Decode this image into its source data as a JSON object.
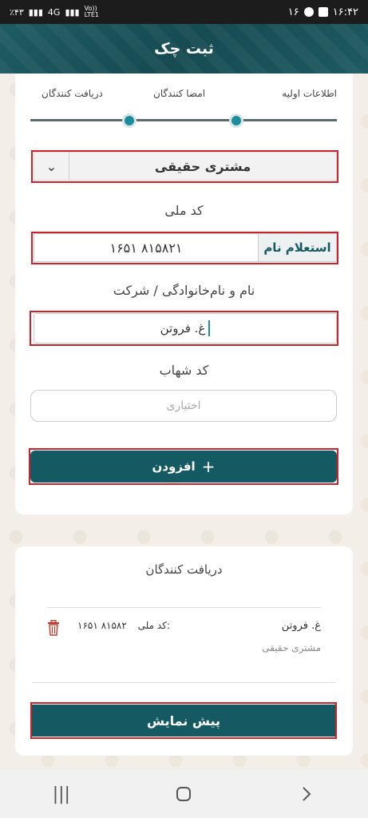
{
  "status_bar": {
    "time": "۱۶:۴۲",
    "notification_count": "۱۶",
    "battery": "٪۴۳",
    "network": "4G",
    "volte": "Vo))\nLTE1"
  },
  "header": {
    "title": "ثبت چک"
  },
  "stepper": {
    "steps": [
      {
        "label": "اطلاعات اولیه"
      },
      {
        "label": "امضا کنندگان"
      },
      {
        "label": "دریافت کنندگان"
      }
    ]
  },
  "form": {
    "customer_type": "مشتری حقیقی",
    "national_code_label": "کد ملی",
    "national_code_value": "۱۶۵۱ ۸۱۵۸۲۱",
    "inquiry_button": "استعلام نام",
    "name_label": "نام و نام‌خانوادگی / شرکت",
    "name_value": "غ. فروتن",
    "shahab_label": "کد شهاب",
    "shahab_placeholder": "اختیاری",
    "add_button": "افزودن",
    "add_icon": "+"
  },
  "receivers": {
    "title": "دریافت کنندگان",
    "items": [
      {
        "name": "غ. فروتن",
        "type": "مشتری حقیقی",
        "code_label": "کد ملی:",
        "code_value": "۱۶۵۱ ۸۱۵۸۲"
      }
    ]
  },
  "preview_button": "پیش نمایش",
  "colors": {
    "primary": "#155a63",
    "accent": "#1c8c9a",
    "highlight": "#d0202a"
  }
}
